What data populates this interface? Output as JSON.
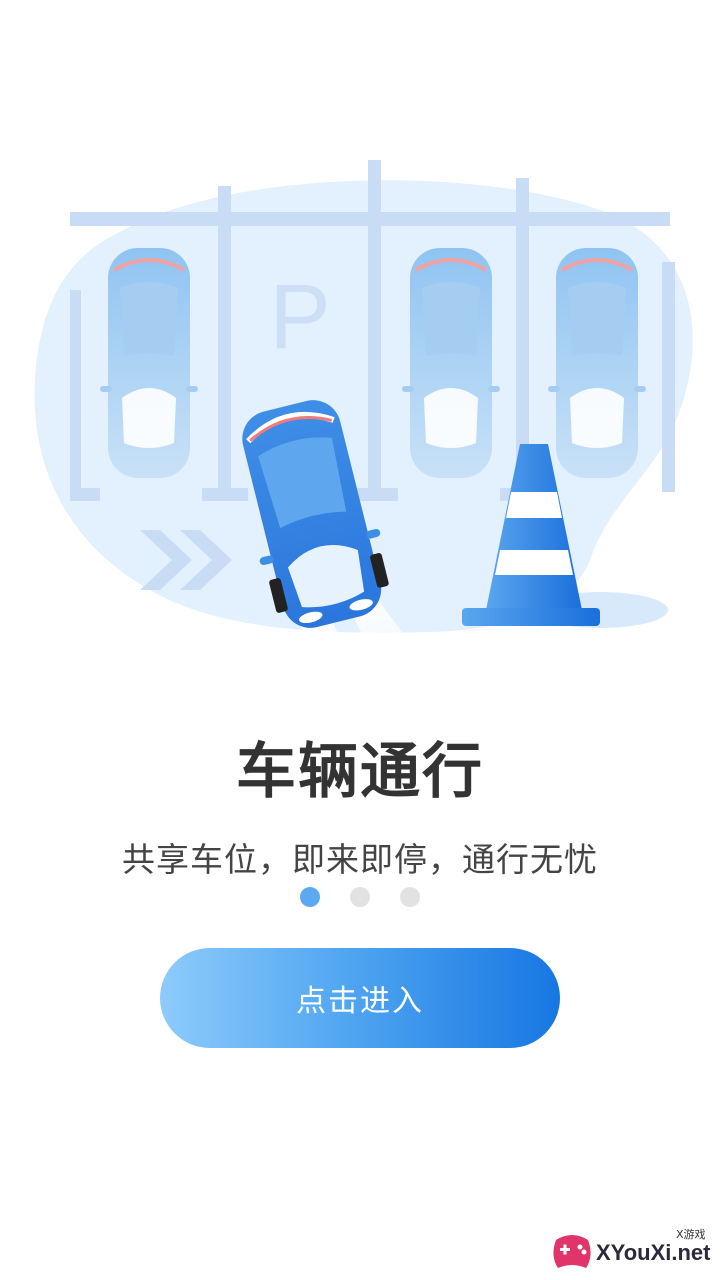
{
  "onboarding": {
    "title": "车辆通行",
    "subtitle": "共享车位，即来即停，通行无忧",
    "pager": {
      "total": 3,
      "active_index": 0
    },
    "enter_button_label": "点击进入"
  },
  "illustration": {
    "parking_sign": "P"
  },
  "watermark": {
    "brand": "XYouXi.net",
    "tag": "X游戏"
  },
  "colors": {
    "accent": "#1777e2",
    "dot_active": "#5aa9f2",
    "dot_inactive": "#e2e2e2",
    "title": "#333333",
    "blob": "#e3f0fd"
  }
}
